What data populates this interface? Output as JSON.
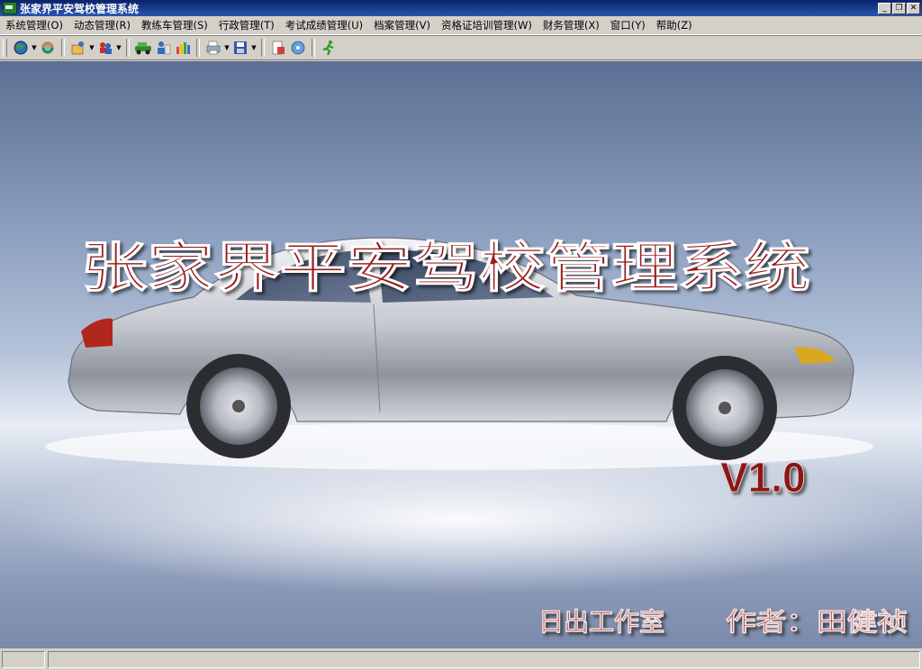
{
  "window": {
    "title": "张家界平安驾校管理系统"
  },
  "menus": [
    "系统管理(O)",
    "动态管理(R)",
    "教练车管理(S)",
    "行政管理(T)",
    "考试成绩管理(U)",
    "档案管理(V)",
    "资格证培训管理(W)",
    "财务管理(X)",
    "窗口(Y)",
    "帮助(Z)"
  ],
  "toolbar": {
    "icons": [
      "globe-icon",
      "refresh-icon",
      "user-icon",
      "people-icon",
      "car-icon",
      "person-info-icon",
      "chart-icon",
      "printer-icon",
      "save-icon",
      "document-icon",
      "disc-icon",
      "runner-icon"
    ]
  },
  "splash": {
    "title": "张家界平安驾校管理系统",
    "version": "V1.0",
    "studio": "日出工作室",
    "author": "作者：田健祯"
  },
  "colors": {
    "accent_red": "#9b1b1b",
    "titlebar": "#0a246a"
  }
}
